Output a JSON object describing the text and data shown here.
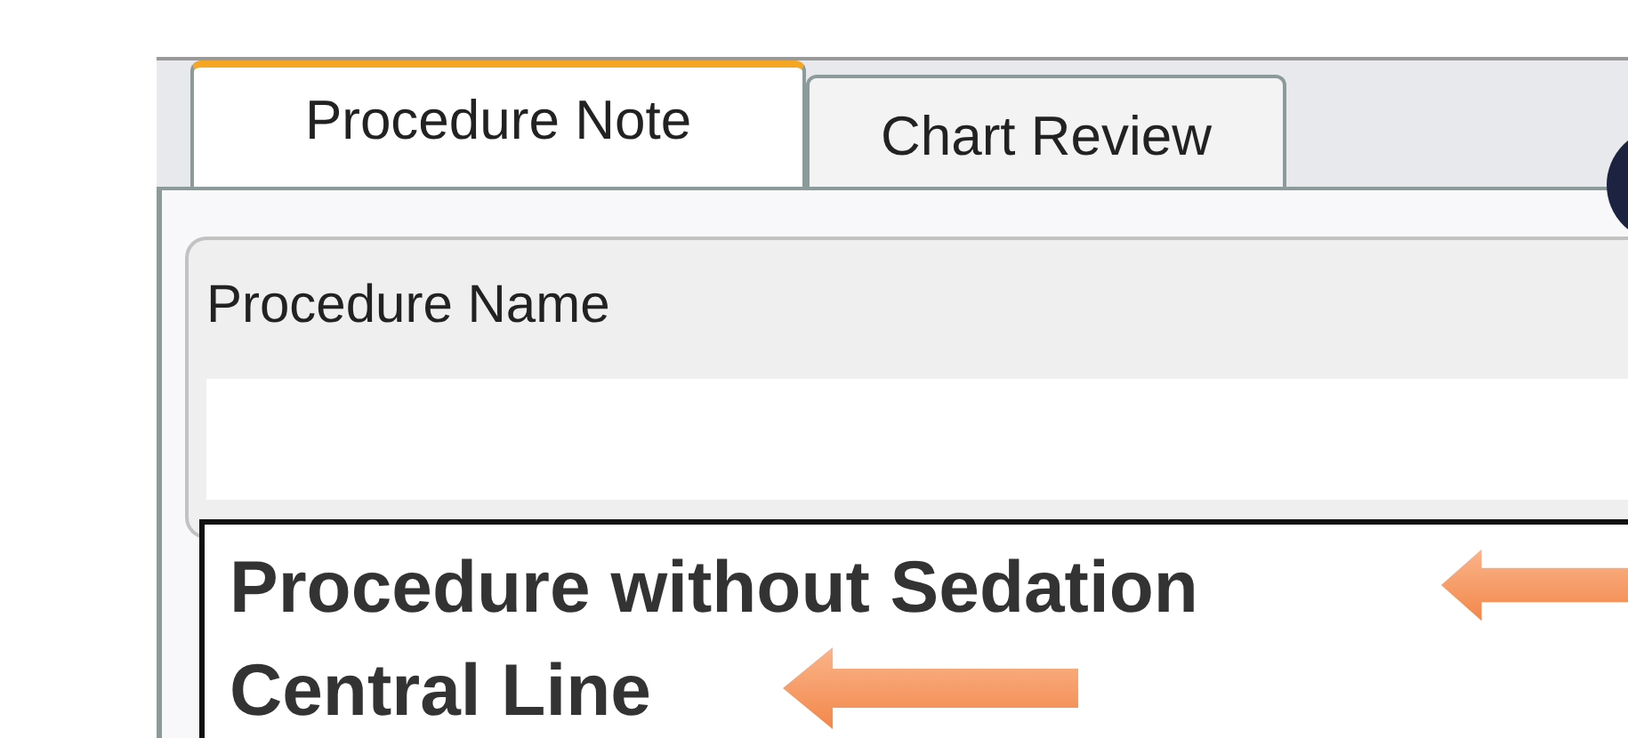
{
  "tabs": [
    {
      "label": "Procedure Note",
      "selected": true
    },
    {
      "label": "Chart Review",
      "selected": false
    }
  ],
  "procedure_name": {
    "label": "Procedure Name"
  },
  "dropdown_options": [
    "Procedure without Sedation",
    "Central Line"
  ]
}
